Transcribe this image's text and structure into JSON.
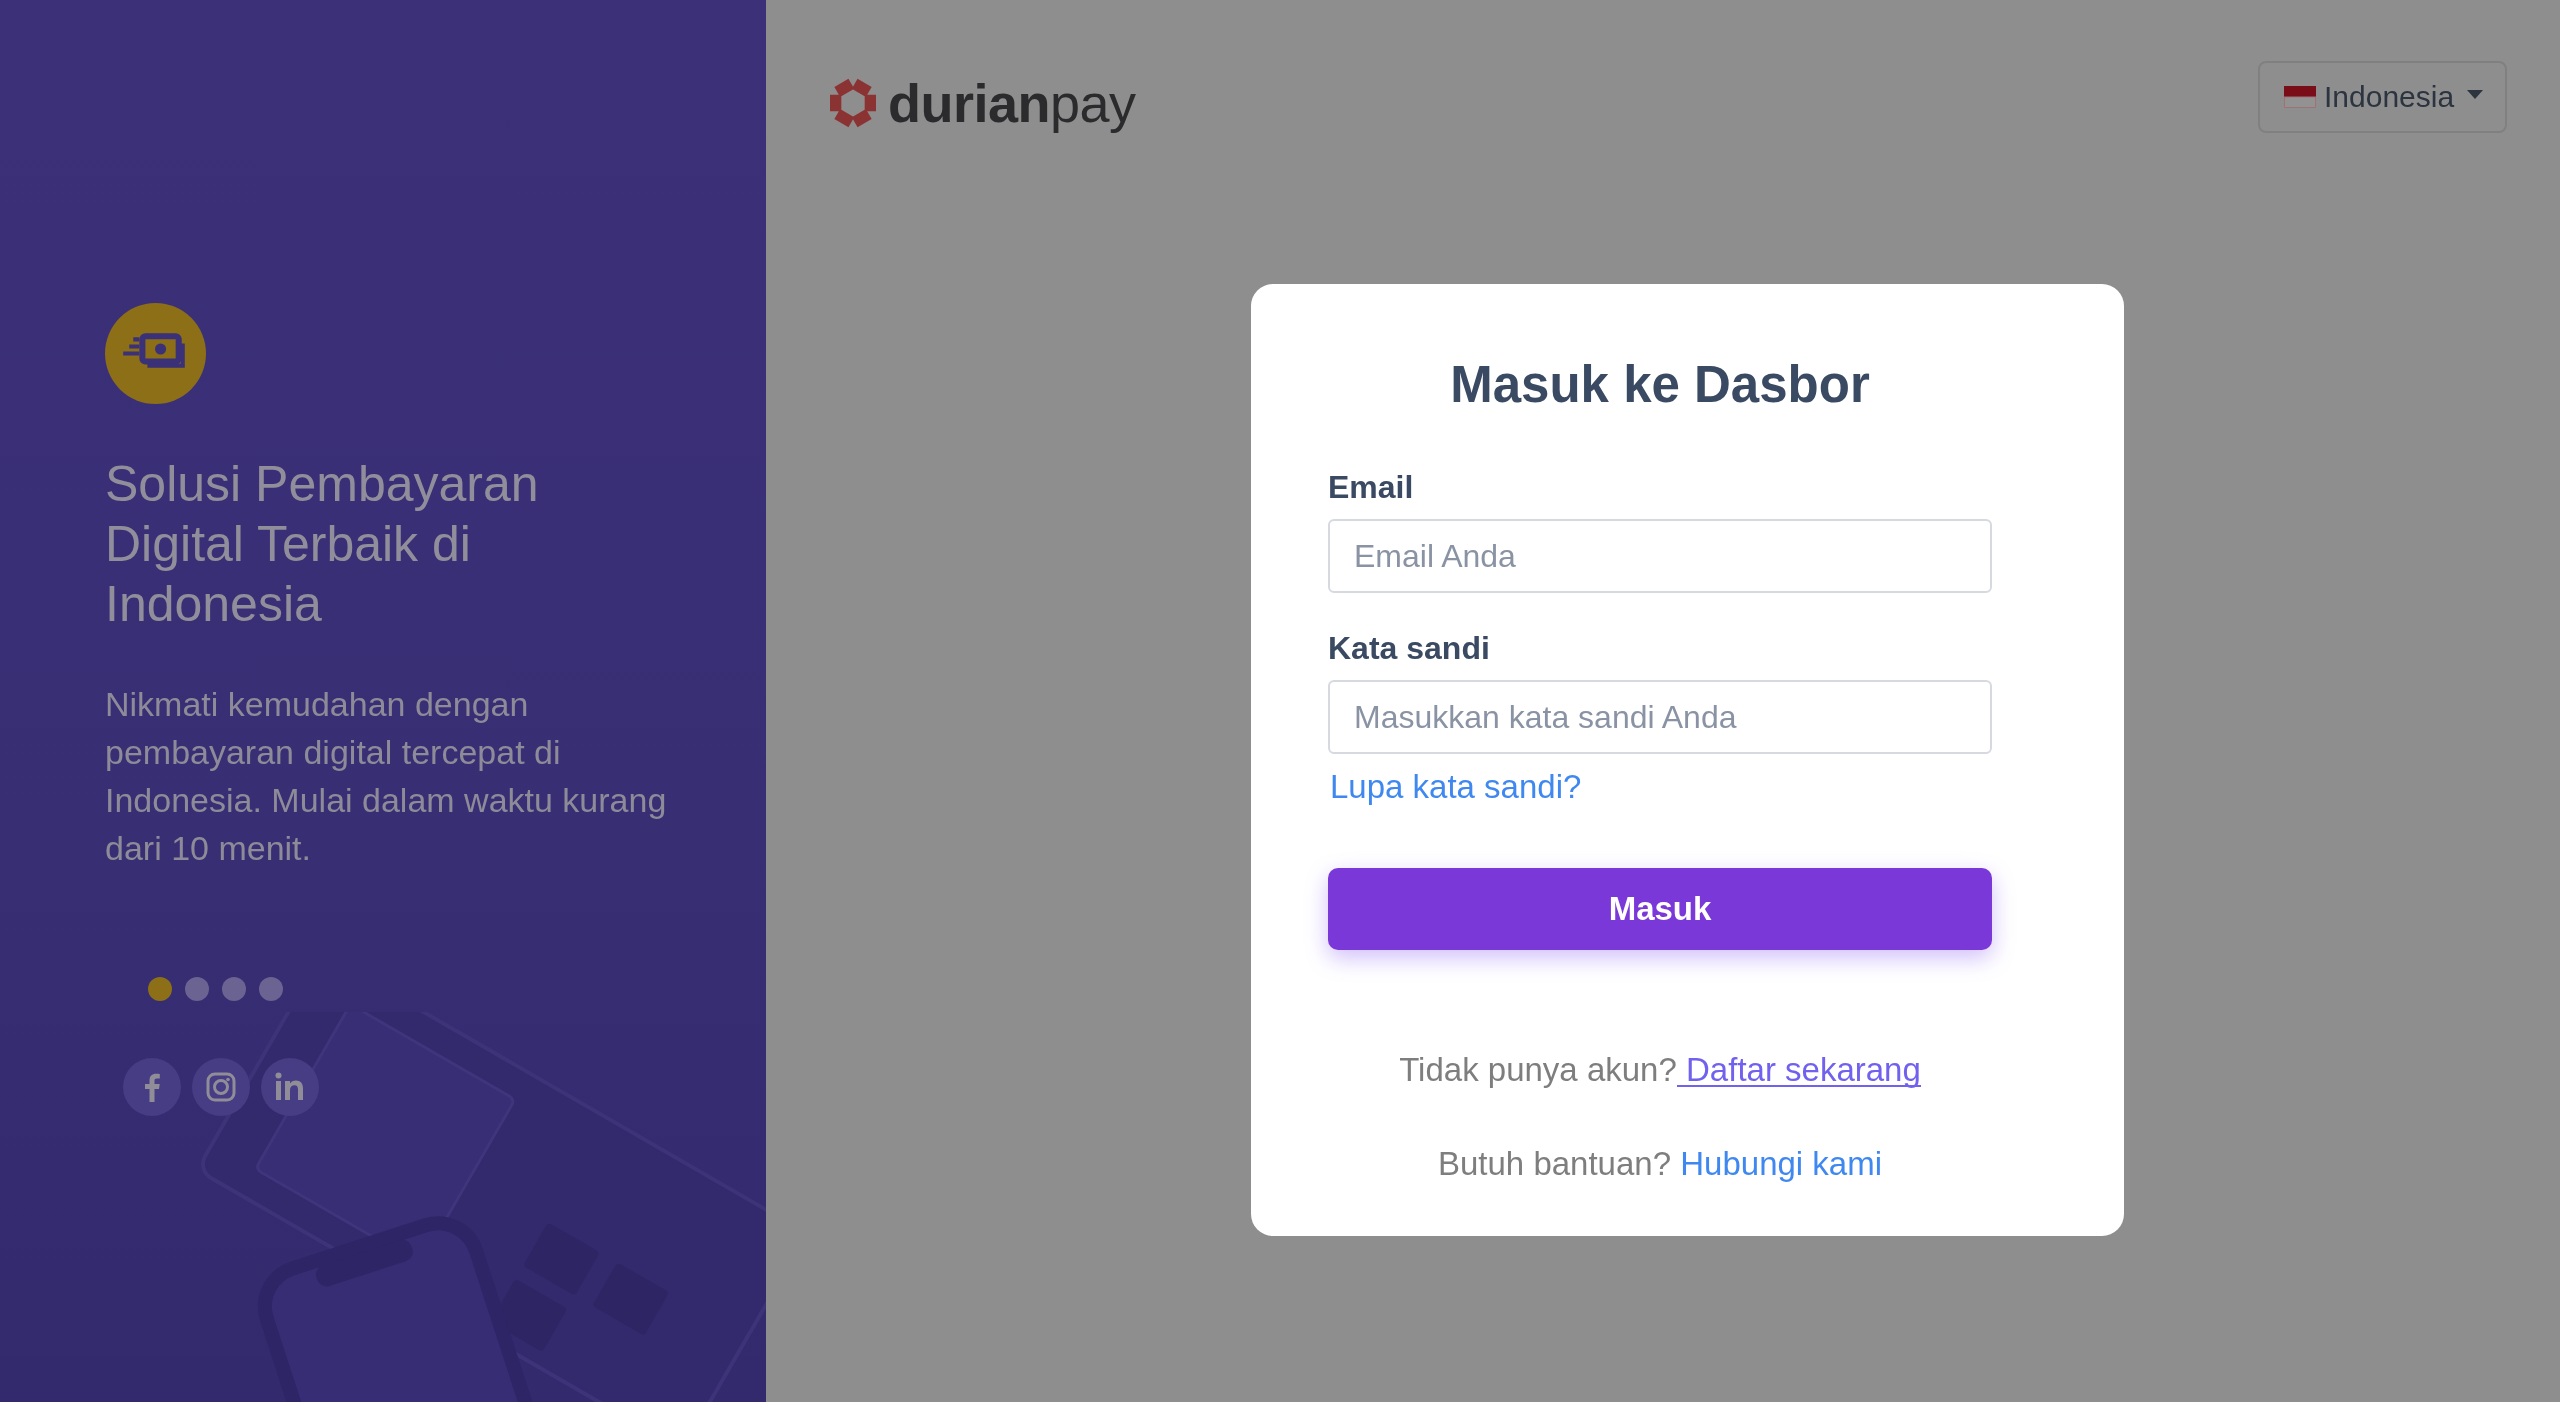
{
  "left_panel": {
    "heading": "Solusi Pembayaran Digital Terbaik di Indonesia",
    "description": "Nikmati kemudahan dengan pembayaran digital tercepat di Indonesia. Mulai dalam waktu kurang dari 10 menit.",
    "carousel_dots": [
      {
        "selected": true
      },
      {
        "selected": false
      },
      {
        "selected": false
      },
      {
        "selected": false
      }
    ]
  },
  "header": {
    "logo": "**durian**pay",
    "language_selector": {
      "value": "Indonesia"
    }
  },
  "login_card": {
    "title": "Masuk ke Dasbor",
    "fields": [
      {
        "label": "Email",
        "placeholder": "Email Anda"
      },
      {
        "label": "Kata sandi",
        "placeholder": "Masukkan kata sandi Anda"
      }
    ],
    "forgot_link": "Lupa kata sandi?",
    "submit_button": "Masuk",
    "signup": {
      "text": "Tidak punya akun?",
      "link": "Daftar sekarang"
    },
    "help": {
      "text": "Butuh bantuan?",
      "link": "Hubungi kami"
    }
  }
}
